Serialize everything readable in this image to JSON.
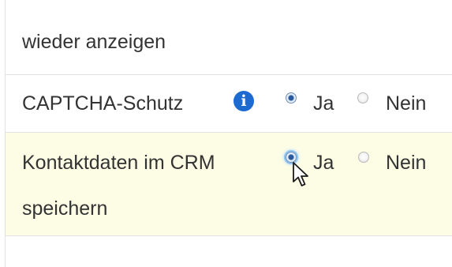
{
  "rows": [
    {
      "label": "wieder anzeigen"
    },
    {
      "label": "CAPTCHA-Schutz",
      "info_icon": "info-icon",
      "info_glyph": "i",
      "options": [
        {
          "label": "Ja",
          "selected": true
        },
        {
          "label": "Nein",
          "selected": false
        }
      ]
    },
    {
      "label_line1": "Kontaktdaten im CRM",
      "label_line2": "speichern",
      "options": [
        {
          "label": "Ja",
          "selected": true
        },
        {
          "label": "Nein",
          "selected": false
        }
      ]
    }
  ],
  "colors": {
    "highlight_row": "#fdfde6",
    "border": "#e2e2e2",
    "text": "#333333",
    "info_icon": "#1d6ad1",
    "radio_checked": "#2a5a9b"
  },
  "icons": {
    "info": "info-icon",
    "cursor": "mouse-pointer-icon"
  }
}
